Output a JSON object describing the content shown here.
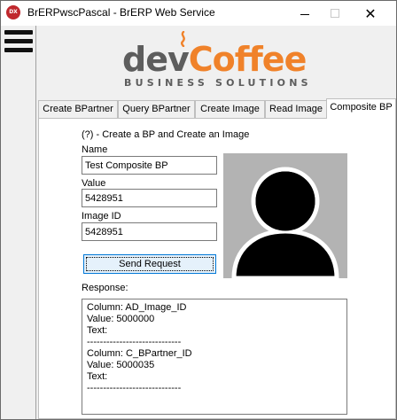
{
  "window": {
    "title": "BrERPwscPascal - BrERP Web Service",
    "app_icon_text": "DX",
    "close_glyph": "✕"
  },
  "logo": {
    "word_dev": "dev",
    "word_coffee": "Coffee",
    "tagline": "BUSINESS SOLUTIONS",
    "color_dev": "#5d5d5d",
    "color_coffee": "#f0822a"
  },
  "tabs": [
    {
      "label": "Create BPartner",
      "active": false
    },
    {
      "label": "Query BPartner",
      "active": false
    },
    {
      "label": "Create Image",
      "active": false
    },
    {
      "label": "Read Image",
      "active": false
    },
    {
      "label": "Composite BP",
      "active": true
    }
  ],
  "form": {
    "heading": "(?) - Create a BP and Create an Image",
    "name_label": "Name",
    "name_value": "Test Composite BP",
    "value_label": "Value",
    "value_value": "5428951",
    "image_id_label": "Image ID",
    "image_id_value": "5428951",
    "send_button": "Send Request",
    "response_label": "Response:"
  },
  "response_lines": [
    "Column: AD_Image_ID",
    "Value: 5000000",
    "Text:",
    "-----------------------------",
    "Column: C_BPartner_ID",
    "Value: 5000035",
    "Text:",
    "-----------------------------"
  ],
  "icons": {
    "menu": "hamburger-menu-icon",
    "avatar": "user-placeholder-icon"
  },
  "colors": {
    "accent": "#0078d7",
    "avatar_bg": "#b3b3b3"
  }
}
